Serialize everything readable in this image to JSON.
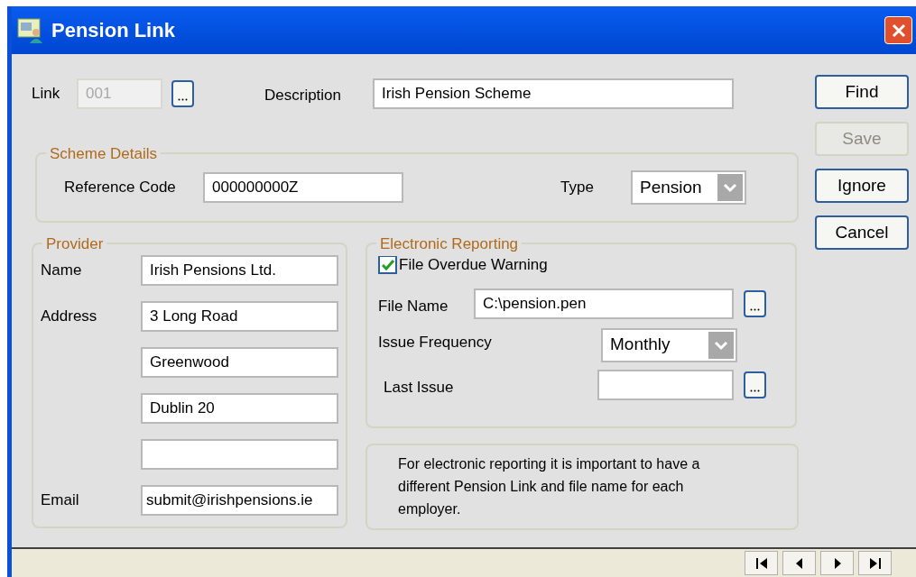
{
  "window": {
    "title": "Pension Link"
  },
  "link": {
    "label": "Link",
    "value": "001",
    "disabled": true
  },
  "description": {
    "label": "Description",
    "value": "Irish Pension Scheme"
  },
  "buttons": [
    {
      "label": "Find",
      "disabled": false
    },
    {
      "label": "Save",
      "disabled": true
    },
    {
      "label": "Ignore",
      "disabled": false
    },
    {
      "label": "Cancel",
      "disabled": false
    }
  ],
  "scheme_details": {
    "title": "Scheme Details",
    "reference_code": {
      "label": "Reference Code",
      "value": "000000000Z"
    },
    "type": {
      "label": "Type",
      "value": "Pension"
    }
  },
  "provider": {
    "title": "Provider",
    "name": {
      "label": "Name",
      "value": "Irish Pensions Ltd."
    },
    "address": {
      "label": "Address",
      "lines": [
        "3 Long Road",
        "Greenwood",
        "Dublin 20"
      ]
    },
    "email": {
      "label": "Email",
      "value": "submit@irishpensions.ie"
    }
  },
  "electronic_reporting": {
    "title": "Electronic Reporting",
    "file_overdue_warning": {
      "label": "File Overdue Warning",
      "checked": true
    },
    "file_name": {
      "label": "File Name",
      "value": "C:\\pension.pen"
    },
    "issue_frequency": {
      "label": "Issue Frequency",
      "value": "Monthly"
    },
    "last_issue": {
      "label": "Last Issue"
    }
  },
  "note": "For electronic reporting it is important to have a different Pension Link and file name for each employer."
}
